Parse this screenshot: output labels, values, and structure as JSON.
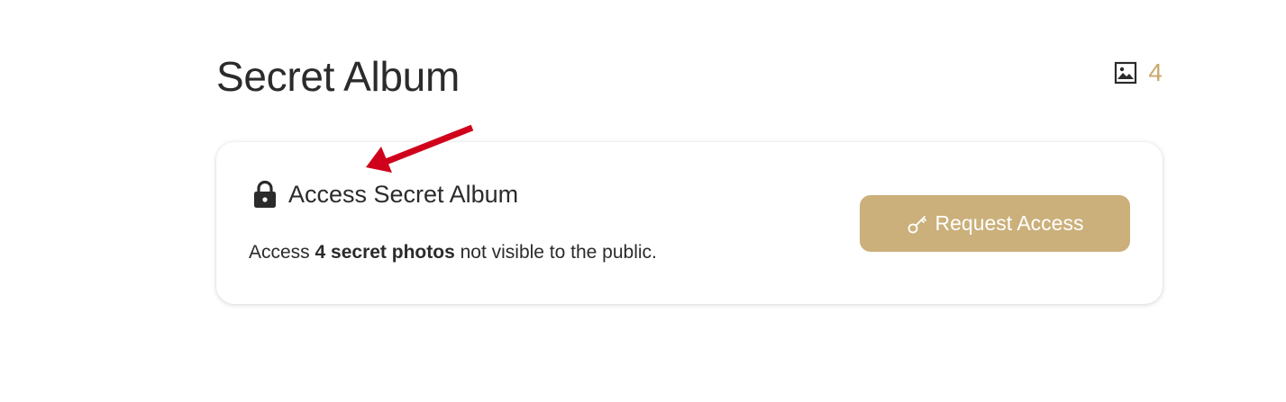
{
  "page": {
    "title": "Secret Album",
    "photo_count": "4"
  },
  "card": {
    "title": "Access Secret Album",
    "desc_prefix": "Access ",
    "desc_bold": "4 secret photos",
    "desc_suffix": " not visible to the public.",
    "button_label": "Request Access"
  },
  "icons": {
    "photo_count": "image-icon",
    "lock": "lock-icon",
    "key": "key-icon",
    "annotation": "arrow-icon"
  },
  "colors": {
    "accent": "#c9a96e",
    "button_bg": "#cbb07b",
    "annotation": "#d0021b"
  }
}
